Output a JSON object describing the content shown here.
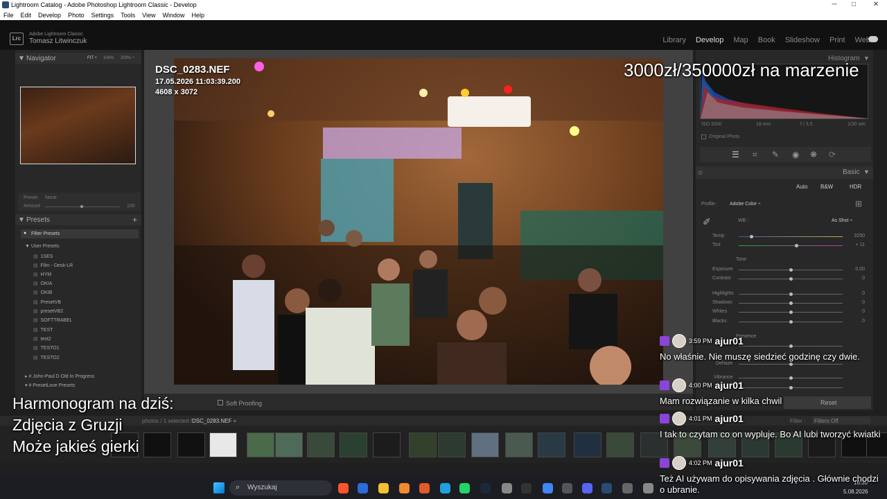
{
  "window": {
    "title": "Lightroom Catalog - Adobe Photoshop Lightroom Classic - Develop",
    "minimize": "─",
    "maximize": "□",
    "close": "✕"
  },
  "menu": [
    "File",
    "Edit",
    "Develop",
    "Photo",
    "Settings",
    "Tools",
    "View",
    "Window",
    "Help"
  ],
  "brand": {
    "app": "Adobe Lightroom Classic",
    "user": "Tomasz Litwinczuk",
    "logo": "Lrc"
  },
  "modules": [
    "Library",
    "Develop",
    "Map",
    "Book",
    "Slideshow",
    "Print",
    "Web"
  ],
  "navigator": {
    "title": "Navigator",
    "zooms": [
      "FIT ÷",
      "100%",
      "200% ÷"
    ]
  },
  "presetAmount": {
    "preset_label": "Preset",
    "preset_value": "None",
    "amount_label": "Amount",
    "amount_value": "100"
  },
  "presets": {
    "title": "Presets",
    "filter": "Filter Presets",
    "group": "User Presets",
    "items": [
      "1SES",
      "Film - Desk-LR",
      "HYM",
      "OKIA",
      "OKIB",
      "PresetVB",
      "presetVB2",
      "SOFTTRABEL",
      "TEST",
      "test2",
      "TESTO1",
      "TESTO2"
    ],
    "more": [
      "# John-Paul D Old In Progress",
      "# PresetLove Presets"
    ]
  },
  "photo": {
    "filename": "DSC_0283.NEF",
    "datetime": "17.05.2026 11:03:39.200",
    "dims": "4608 x 3072"
  },
  "toolbar": {
    "soft_proofing": "Soft Proofing"
  },
  "histogram": {
    "title": "Histogram",
    "iso": "ISO 3200",
    "focal": "18 mm",
    "aperture": "f / 3,5",
    "shutter": "1/30 sec",
    "original": "Original Photo"
  },
  "basic": {
    "title": "Basic",
    "auto": "Auto",
    "bw": "B&W",
    "hdr": "HDR",
    "profile_label": "Profile :",
    "profile_value": "Adobe Color ÷",
    "wb_label": "WB :",
    "wb_value": "As Shot ÷",
    "temp": {
      "label": "Temp",
      "value": "3250",
      "pos": 0.12
    },
    "tint": {
      "label": "Tint",
      "value": "+ 11",
      "pos": 0.55
    },
    "tone": "Tone",
    "exposure": {
      "label": "Exposure",
      "value": "0,00",
      "pos": 0.5
    },
    "contrast": {
      "label": "Contrast",
      "value": "0",
      "pos": 0.5
    },
    "highlights": {
      "label": "Highlights",
      "value": "0",
      "pos": 0.5
    },
    "shadows": {
      "label": "Shadows",
      "value": "0",
      "pos": 0.5
    },
    "whites": {
      "label": "Whites",
      "value": "0",
      "pos": 0.5
    },
    "blacks": {
      "label": "Blacks",
      "value": "0",
      "pos": 0.5
    },
    "presence": "Presence",
    "dehaze": "Dehaze",
    "vibrance": "Vibrance",
    "reset": "Reset"
  },
  "filmstrip": {
    "info": "photos / 1 selected /",
    "file": "DSC_0283.NEF ÷",
    "filter_label": "Filter :",
    "filter_value": "Filters Off"
  },
  "overlay": {
    "goal": "3000zł/350000zł na marzenie",
    "line1": "Harmonogram na dziś:",
    "line2": "Zdjęcia z Gruzji",
    "line3": "Może jakieś gierki"
  },
  "chat": [
    {
      "time": "3:59 PM",
      "user": "ajur01",
      "text": "No właśnie. Nie muszę siedzieć godzinę czy dwie."
    },
    {
      "time": "4:00 PM",
      "user": "ajur01",
      "text": "Mam rozwiązanie w kilka chwil"
    },
    {
      "time": "4:01 PM",
      "user": "ajur01",
      "text": "I tak to czytam co on wypluje. Bo AI lubi tworzyć kwiatki"
    },
    {
      "time": "4:02 PM",
      "user": "ajur01",
      "text": "Też AI używam do opisywania zdjęcia . Głównie chodzi o ubranie."
    }
  ],
  "taskbar": {
    "search": "Wyszukaj",
    "time": "16:30",
    "date": "5.08.2026"
  }
}
